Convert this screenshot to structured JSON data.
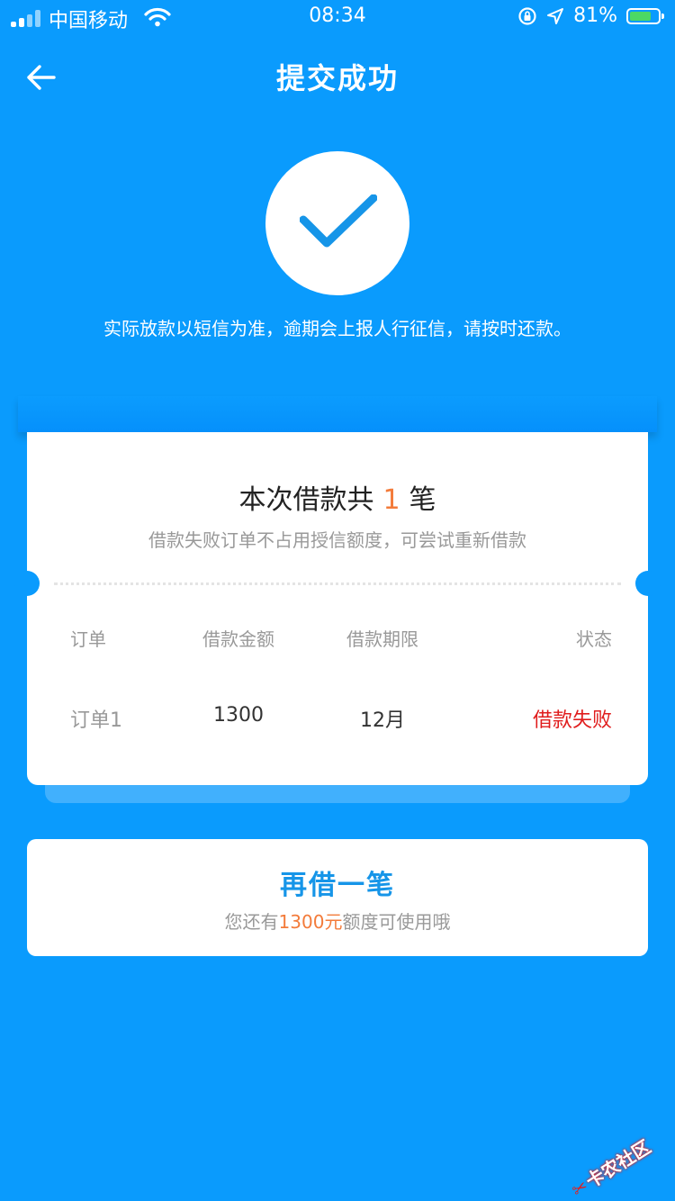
{
  "status_bar": {
    "carrier": "中国移动",
    "time": "08:34",
    "battery_percent": "81%",
    "battery_level": 0.81,
    "icons": [
      "signal-icon",
      "wifi-icon",
      "rotation-lock-icon",
      "location-icon",
      "battery-icon"
    ]
  },
  "nav": {
    "title": "提交成功",
    "back_icon": "back-arrow-icon"
  },
  "success": {
    "icon": "check-icon",
    "notice": "实际放款以短信为准，逾期会上报人行征信，请按时还款。"
  },
  "summary": {
    "title_prefix": "本次借款共",
    "count": "1",
    "title_suffix": "笔",
    "subtitle": "借款失败订单不占用授信额度，可尝试重新借款"
  },
  "table": {
    "headers": [
      "订单",
      "借款金额",
      "借款期限",
      "状态"
    ],
    "rows": [
      {
        "order": "订单1",
        "amount": "1300",
        "term": "12月",
        "status": "借款失败"
      }
    ]
  },
  "borrow_again": {
    "title": "再借一笔",
    "sub_prefix": "您还有",
    "sub_amount": "1300元",
    "sub_suffix": "额度可使用哦"
  },
  "watermark": {
    "text": "卡农社区"
  },
  "colors": {
    "background": "#0a9bfd",
    "accent_blue": "#1695e8",
    "orange": "#f37b3a",
    "fail_red": "#e01c1c"
  }
}
